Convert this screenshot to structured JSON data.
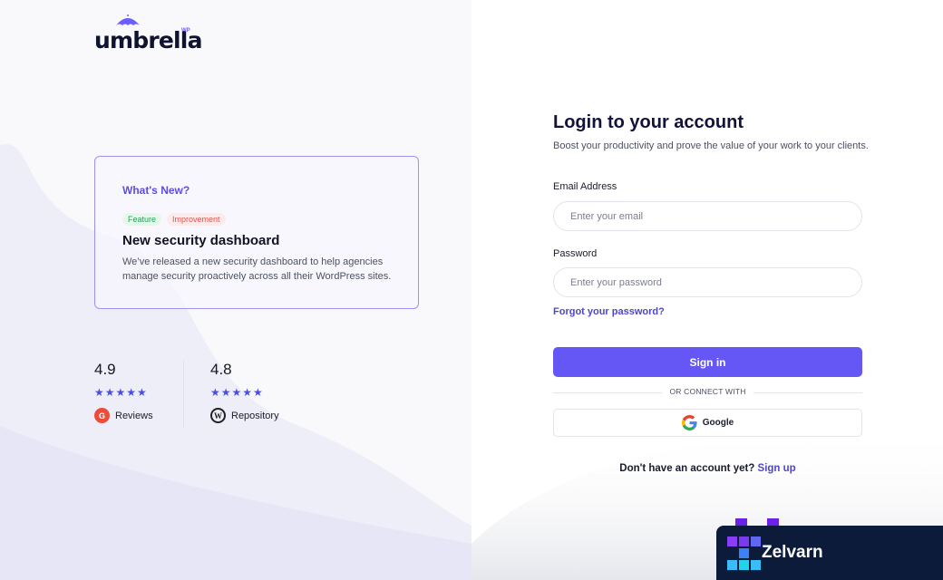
{
  "brand": {
    "logo_text": "umbrella",
    "logo_suffix": "WP"
  },
  "whats_new": {
    "title": "What's New?",
    "tags": [
      "Feature",
      "Improvement"
    ],
    "headline": "New security dashboard",
    "description": "We’ve released a new security dashboard to help agencies manage security proactively across all their WordPress sites."
  },
  "ratings": [
    {
      "score": "4.9",
      "stars": 5,
      "source": "Reviews",
      "icon": "g2-icon"
    },
    {
      "score": "4.8",
      "stars": 5,
      "source": "Repository",
      "icon": "wordpress-icon"
    }
  ],
  "login": {
    "title": "Login to your account",
    "subtitle": "Boost your productivity and prove the value of your work to your clients.",
    "email_label": "Email Address",
    "email_placeholder": "Enter your email",
    "password_label": "Password",
    "password_placeholder": "Enter your password",
    "forgot": "Forgot your password?",
    "sign_in": "Sign in",
    "or_connect": "OR CONNECT WITH",
    "google": "Google",
    "no_account": "Don't have an account yet?",
    "sign_up": "Sign up"
  },
  "badge": {
    "name": "Zelvarn"
  },
  "colors": {
    "accent": "#6557f5",
    "link": "#4f46c8",
    "star": "#4a4fe0",
    "badge_bg": "#0c1b3a"
  }
}
